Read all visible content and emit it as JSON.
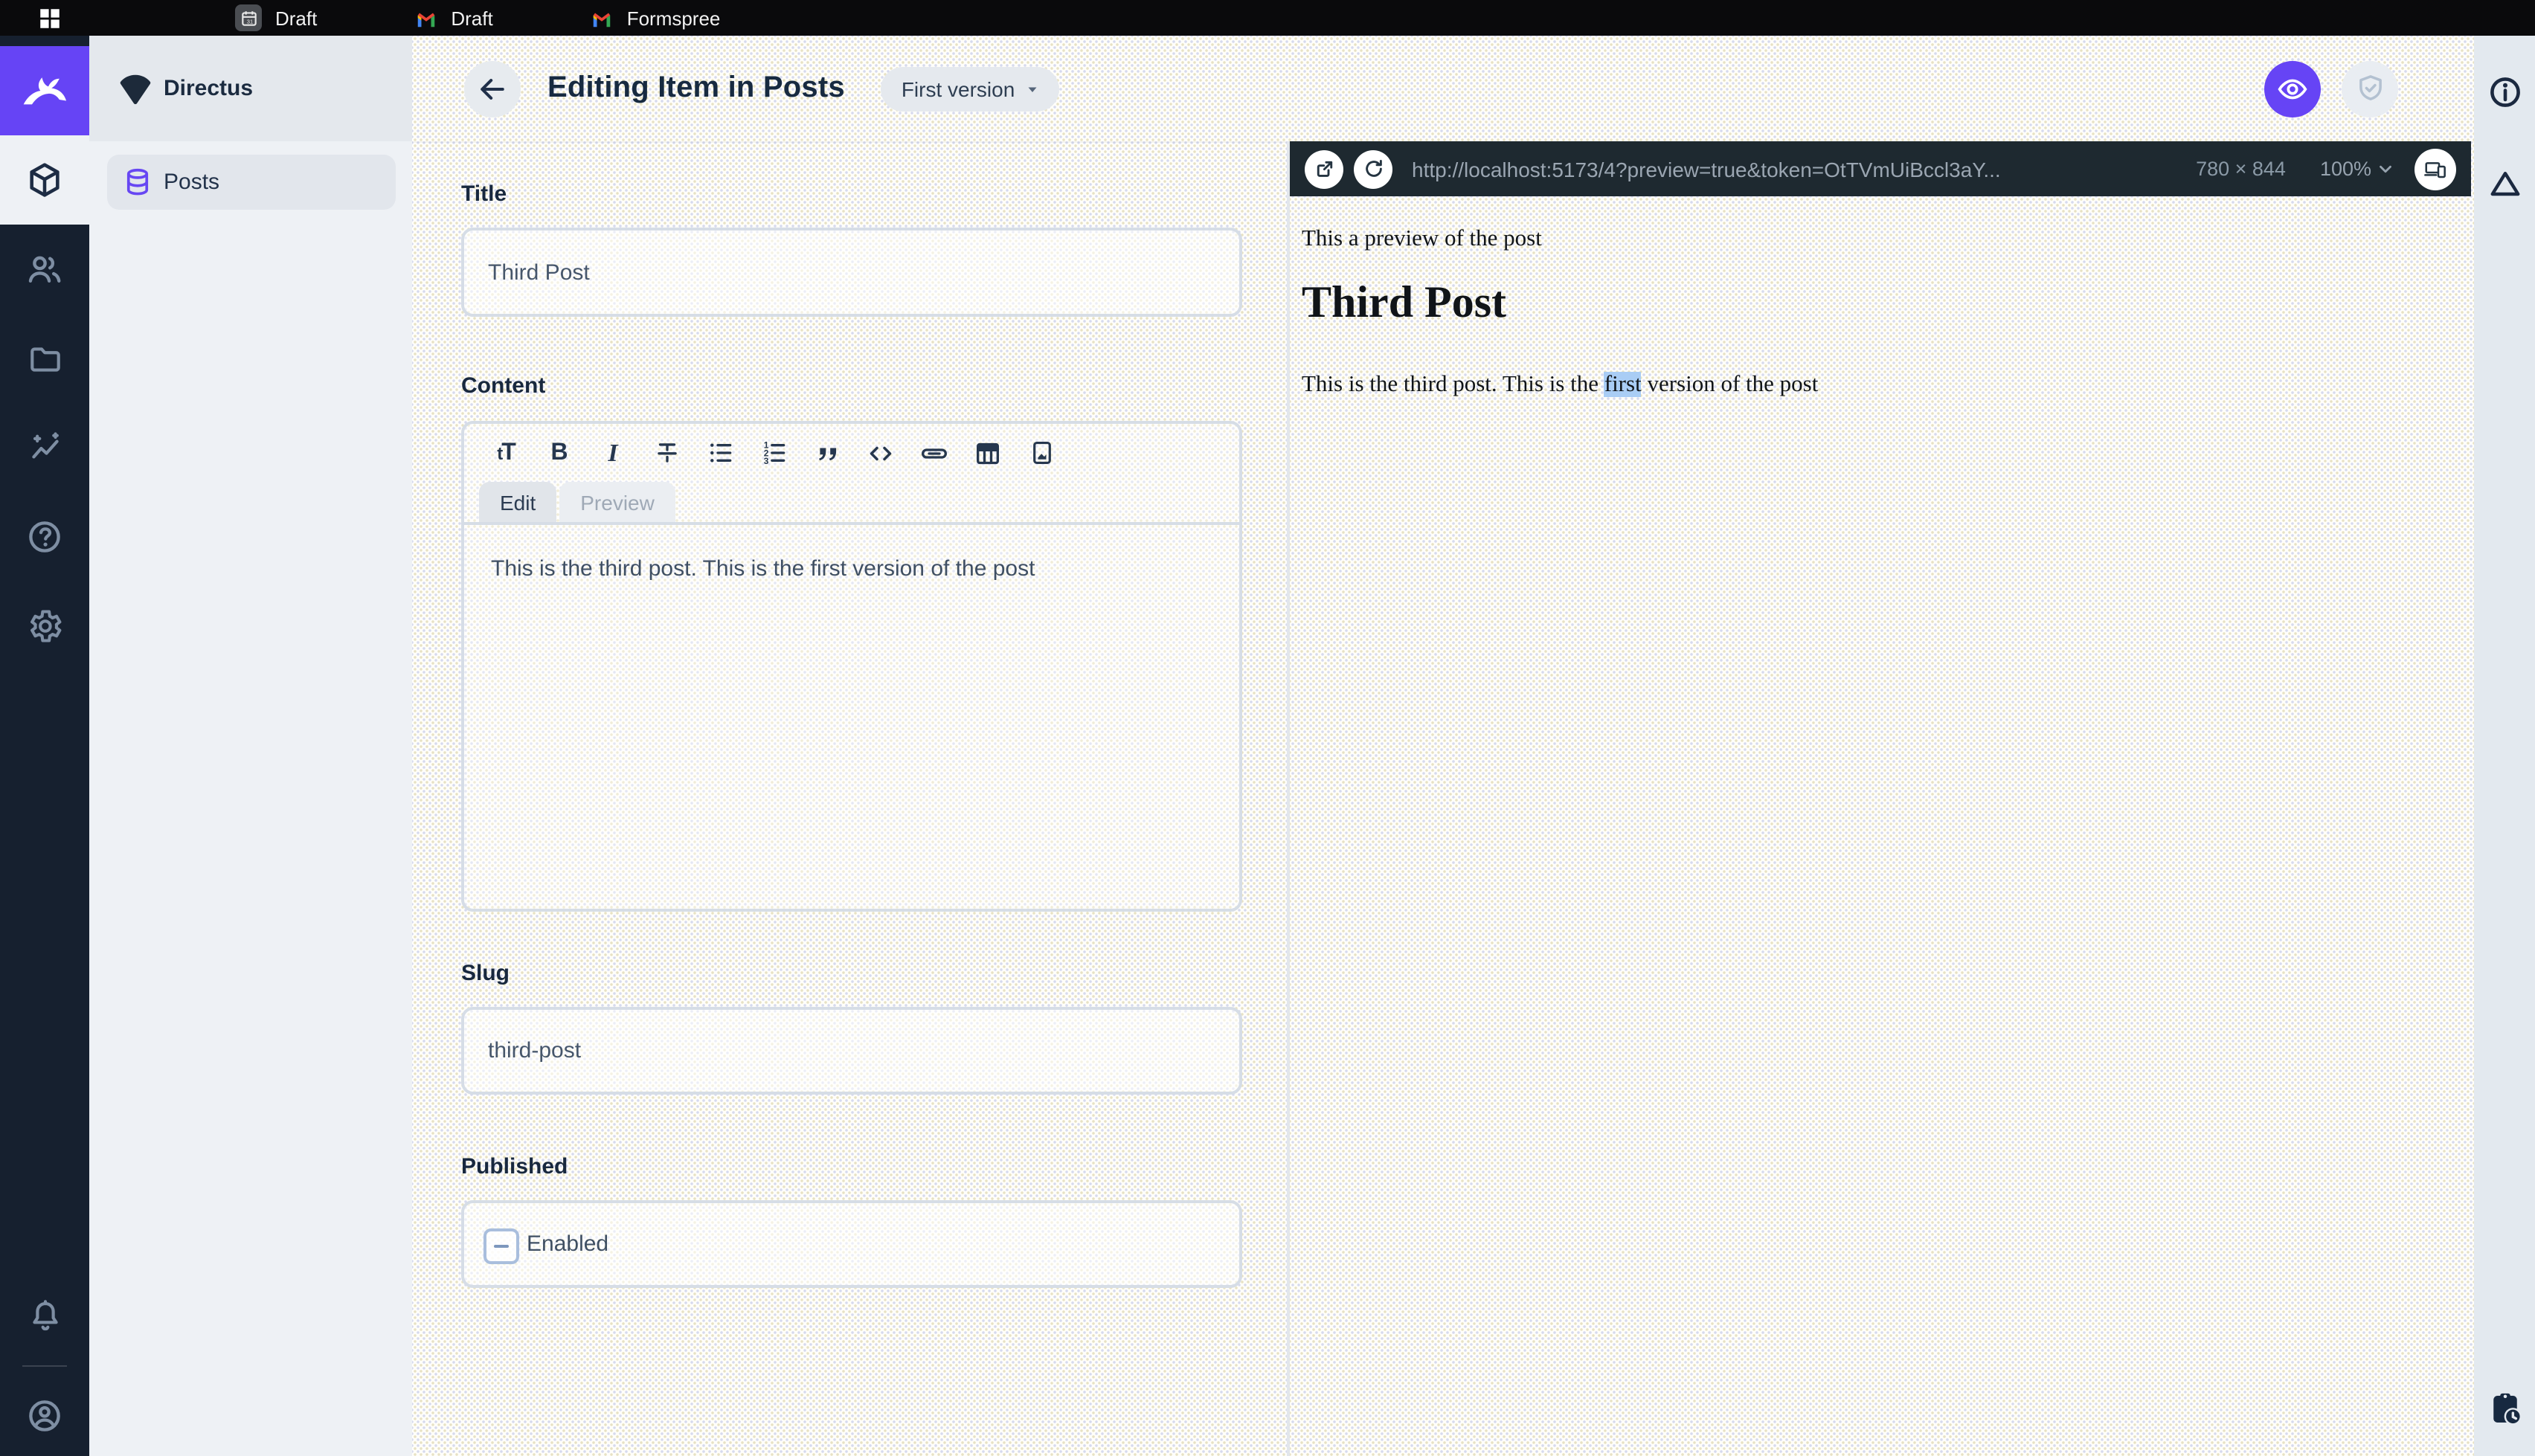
{
  "os_bar": {
    "tabs": [
      {
        "label": "Draft",
        "icon": "calendar-icon"
      },
      {
        "label": "Draft",
        "icon": "gmail-icon"
      },
      {
        "label": "Formspree",
        "icon": "gmail-icon"
      }
    ]
  },
  "sidebar": {
    "project_name": "Directus",
    "items": [
      {
        "label": "Posts",
        "icon": "database-icon"
      }
    ]
  },
  "header": {
    "title": "Editing Item in Posts",
    "version_badge": "First version"
  },
  "form": {
    "title": {
      "label": "Title",
      "value": "Third Post"
    },
    "content": {
      "label": "Content",
      "tabs": [
        "Edit",
        "Preview"
      ],
      "value": "This is the third post. This is the first version of the post"
    },
    "slug": {
      "label": "Slug",
      "value": "third-post"
    },
    "published": {
      "label": "Published",
      "value": "Enabled"
    }
  },
  "preview": {
    "url": "http://localhost:5173/4?preview=true&token=OtTVmUiBccl3aY...",
    "dimensions": "780 × 844",
    "zoom": "100%",
    "doc": {
      "intro": "This a preview of the post",
      "title": "Third Post",
      "para_before": "This is the third post. This is the ",
      "para_highlight": "first",
      "para_after": " version of the post"
    }
  },
  "icons": {
    "module_bar": [
      "directus-rabbit-logo",
      "content-module-icon",
      "users-module-icon",
      "files-module-icon",
      "insights-module-icon",
      "help-module-icon",
      "settings-module-icon",
      "notifications-bell-icon",
      "account-avatar-icon"
    ],
    "toolbar": [
      "heading-icon",
      "bold-icon",
      "italic-icon",
      "strikethrough-icon",
      "bullet-list-icon",
      "numbered-list-icon",
      "blockquote-icon",
      "code-icon",
      "link-icon",
      "table-icon",
      "image-icon"
    ],
    "right_strip": [
      "info-icon",
      "delta-triangle-icon",
      "clipboard-clock-icon"
    ]
  },
  "colors": {
    "accent_purple": "#6644f5",
    "module_bar_bg": "#16202f",
    "preview_bar_bg": "#1e2930",
    "selection_highlight": "#a9cdf5"
  }
}
